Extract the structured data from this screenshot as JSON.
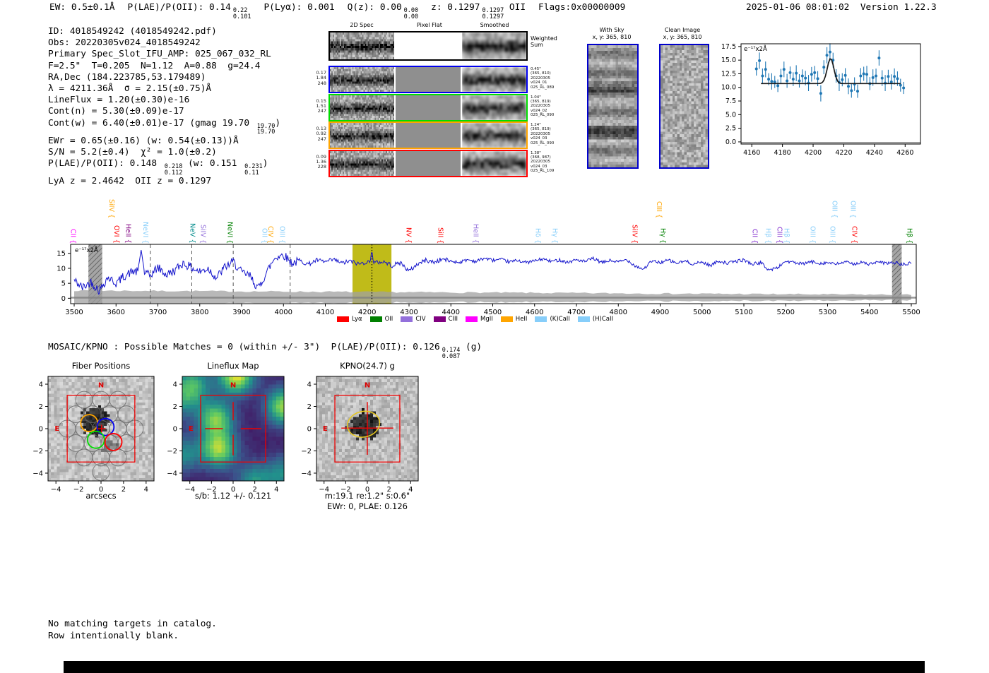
{
  "header": {
    "segments": [
      {
        "text": "EW: 0.5±0.1Å"
      },
      {
        "text": "P(LAE)/P(OII): 0.14",
        "sup": "0.22",
        "sub": "0.101"
      },
      {
        "text": "P(Lyα): 0.001"
      },
      {
        "text": "Q(z): 0.00",
        "sup": "0.00",
        "sub": "0.00"
      },
      {
        "text": "z: 0.1297",
        "sup": "0.1297",
        "sub": "0.1297",
        "after": " OII"
      },
      {
        "text": "Flags:0x00000009"
      }
    ],
    "timestamp": "2025-01-06 08:01:02",
    "version": "Version 1.22.3"
  },
  "info": {
    "lines": [
      [
        {
          "t": "ID: 4018549242 (4018549242.pdf)"
        }
      ],
      [
        {
          "t": "Obs: 20220305v024_4018549242"
        }
      ],
      [
        {
          "t": "Primary Spec_Slot_IFU_AMP: 025_067_032_RL"
        }
      ],
      [
        {
          "t": "F=2.5\"  T=0.205  N=1.12  A=0.88  g=24.4"
        }
      ],
      [
        {
          "t": "RA,Dec (184.223785,53.179489)"
        }
      ],
      [
        {
          "t": "λ = 4211.36Å  σ = 2.15(±0.75)Å"
        }
      ],
      [
        {
          "t": "LineFlux = 1.20(±0.30)e-16"
        }
      ],
      [
        {
          "t": "Cont(n) = 5.30(±0.09)e-17"
        }
      ],
      [
        {
          "t": "Cont(w) = 6.40(±0.01)e-17 (gmag 19.70 "
        },
        {
          "sup": "19.70",
          "sub": "19.70"
        },
        {
          "t": ")"
        }
      ],
      [
        {
          "t": "EWr = 0.65(±0.16) (w: 0.54(±0.13))Å"
        }
      ],
      [
        {
          "t": "S/N = 5.2(±0.4)  χ² = 1.0(±0.2)"
        }
      ],
      [
        {
          "t": "P(LAE)/P(OII): 0.148 "
        },
        {
          "sup": "0.218",
          "sub": "0.112"
        },
        {
          "t": " (w: 0.151 "
        },
        {
          "sup": "0.231",
          "sub": "0.11"
        },
        {
          "t": ")"
        }
      ],
      [
        {
          "t": "LyA z = 2.4642  OII z = 0.1297"
        }
      ]
    ]
  },
  "spec2d": {
    "col_titles": [
      "2D Spec",
      "Pixel Flat",
      "Smoothed"
    ],
    "weighted_label": "Weighted Sum",
    "rows": [
      {
        "left": [
          "0.17",
          "1.84",
          "248"
        ],
        "right": [
          "0.45\"",
          "(365, 810)",
          "20220305",
          "v024_01",
          "025_RL_089"
        ],
        "color": "#0000ee"
      },
      {
        "left": [
          "0.15",
          "1.51",
          "247"
        ],
        "right": [
          "1.04\"",
          "(365, 819)",
          "20220305",
          "v024_02",
          "025_RL_090"
        ],
        "color": "#00dd00"
      },
      {
        "left": [
          "0.13",
          "0.92",
          "247"
        ],
        "right": [
          "1.24\"",
          "(365, 819)",
          "20220305",
          "v024_03",
          "025_RL_090"
        ],
        "color": "#ffa500"
      },
      {
        "left": [
          "0.09",
          "1.36",
          "228"
        ],
        "right": [
          "1.38\"",
          "(368, 987)",
          "20220305",
          "v024_03",
          "025_RL_109"
        ],
        "color": "#ff0000"
      }
    ]
  },
  "cutouts": {
    "with_sky": {
      "title": "With Sky",
      "subtitle": "x, y: 365, 810"
    },
    "clean": {
      "title": "Clean Image",
      "subtitle": "x, y: 365, 810"
    }
  },
  "mosaic": {
    "prefix": "MOSAIC/KPNO : Possible Matches = 0 (within +/- 3\")  P(LAE)/P(OII): 0.126",
    "sup": "0.174",
    "sub": "0.087",
    "after": " (g)"
  },
  "footer": [
    "No matching targets in catalog.",
    "Row intentionally blank."
  ],
  "chart_data": [
    {
      "id": "zoom-spectrum",
      "type": "scatter",
      "annotation": "e⁻¹⁷x2Å",
      "x": [
        4163,
        4165,
        4167,
        4169,
        4171,
        4173,
        4175,
        4177,
        4179,
        4181,
        4183,
        4185,
        4187,
        4189,
        4191,
        4193,
        4195,
        4197,
        4199,
        4201,
        4203,
        4205,
        4207,
        4209,
        4211,
        4213,
        4215,
        4217,
        4219,
        4221,
        4223,
        4225,
        4227,
        4229,
        4231,
        4233,
        4235,
        4237,
        4239,
        4241,
        4243,
        4245,
        4247,
        4249,
        4251,
        4253,
        4255,
        4257,
        4259
      ],
      "y": [
        13.4,
        14.9,
        12.1,
        13.3,
        11.5,
        11.1,
        11.0,
        10.3,
        12.1,
        13.3,
        11.2,
        12.7,
        11.5,
        12.6,
        11.2,
        12.1,
        11.7,
        10.8,
        12.4,
        12.7,
        11.6,
        8.9,
        13.7,
        15.9,
        16.5,
        15.0,
        12.1,
        10.9,
        11.4,
        12.2,
        10.2,
        9.4,
        10.6,
        9.3,
        12.1,
        12.5,
        12.4,
        10.7,
        11.8,
        12.1,
        15.4,
        11.7,
        10.8,
        12.0,
        11.0,
        12.0,
        11.6,
        10.4,
        9.9
      ],
      "yerr": 1.1,
      "fit": {
        "center": 4211.36,
        "sigma": 2.15,
        "amplitude": 4.6,
        "baseline": 10.7,
        "x_start": 4166,
        "x_end": 4257
      },
      "xticks": [
        4160,
        4180,
        4200,
        4220,
        4240,
        4260
      ],
      "yticks": [
        0.0,
        2.5,
        5.0,
        7.5,
        10.0,
        12.5,
        15.0,
        17.5
      ],
      "xlim": [
        4153,
        4270
      ],
      "ylim": [
        -0.4,
        18.0
      ],
      "point_color": "#1f77b4",
      "fit_color": "#1a1a1a"
    },
    {
      "id": "full-spectrum",
      "type": "line",
      "annotation": "e⁻¹⁷x2Å",
      "x": [
        3500,
        3520,
        3540,
        3560,
        3580,
        3600,
        3620,
        3640,
        3652,
        3660,
        3668,
        3680,
        3700,
        3720,
        3740,
        3760,
        3780,
        3800,
        3820,
        3840,
        3860,
        3880,
        3900,
        3920,
        3940,
        3960,
        3980,
        4000,
        4020,
        4040,
        4060,
        4080,
        4100,
        4120,
        4140,
        4160,
        4180,
        4200,
        4207,
        4211,
        4215,
        4220,
        4240,
        4260,
        4280,
        4300,
        4320,
        4340,
        4360,
        4380,
        4400,
        4420,
        4440,
        4460,
        4480,
        4500,
        4520,
        4540,
        4560,
        4580,
        4600,
        4620,
        4640,
        4660,
        4680,
        4700,
        4720,
        4740,
        4760,
        4780,
        4800,
        4820,
        4840,
        4860,
        4880,
        4900,
        4920,
        4940,
        4960,
        4980,
        5000,
        5020,
        5040,
        5060,
        5080,
        5100,
        5120,
        5140,
        5160,
        5180,
        5200,
        5220,
        5240,
        5260,
        5280,
        5300,
        5320,
        5340,
        5360,
        5380,
        5400,
        5420,
        5440,
        5460,
        5480,
        5500
      ],
      "y": [
        6.0,
        3.5,
        5.5,
        2.5,
        7.0,
        5.0,
        7.5,
        9.0,
        8.8,
        16.2,
        8.6,
        7.5,
        10.3,
        7.8,
        9.2,
        11.8,
        10.2,
        8.8,
        10.0,
        6.8,
        10.4,
        12.2,
        8.6,
        7.4,
        3.2,
        8.8,
        13.6,
        14.6,
        11.8,
        12.4,
        11.4,
        12.7,
        12.1,
        12.9,
        11.7,
        12.4,
        11.4,
        12.2,
        11.8,
        16.5,
        11.6,
        11.9,
        12.2,
        10.9,
        11.9,
        9.0,
        11.4,
        12.7,
        12.0,
        13.1,
        12.4,
        12.0,
        12.9,
        12.3,
        13.4,
        12.7,
        12.9,
        12.1,
        12.7,
        11.9,
        12.5,
        13.1,
        12.3,
        12.8,
        12.0,
        12.9,
        12.2,
        13.3,
        11.9,
        12.6,
        12.1,
        12.9,
        10.9,
        9.7,
        12.4,
        11.9,
        12.7,
        11.7,
        12.4,
        11.4,
        12.1,
        10.9,
        12.5,
        11.7,
        12.3,
        12.8,
        11.4,
        11.9,
        9.4,
        10.2,
        12.4,
        11.9,
        11.4,
        12.2,
        11.7,
        11.9,
        11.3,
        12.1,
        11.5,
        11.9,
        11.4,
        12.0,
        11.7,
        11.9,
        11.2,
        11.7
      ],
      "xlim": [
        3491,
        5512
      ],
      "ylim": [
        -1.8,
        18.0
      ],
      "xticks": [
        3500,
        3600,
        3700,
        3800,
        3900,
        4000,
        4100,
        4200,
        4300,
        4400,
        4500,
        4600,
        4700,
        4800,
        4900,
        5000,
        5100,
        5200,
        5300,
        5400,
        5500
      ],
      "yticks": [
        0,
        5,
        10,
        15
      ],
      "line_color": "#1414cc",
      "highlight_band": {
        "x0": 4165,
        "x1": 4258,
        "color": "#b9b400"
      },
      "hatch_bands": [
        [
          3534,
          3567
        ],
        [
          5454,
          5477
        ]
      ],
      "dashed_lines": [
        3682,
        3781,
        3880,
        4016
      ],
      "dotted_line": 4211.36,
      "error_band": {
        "start_hw": 2.3,
        "end_hw": 0.85,
        "color": "#a0a0a0"
      },
      "legend": [
        {
          "label": "Lyα",
          "color": "#ff0000"
        },
        {
          "label": "OII",
          "color": "#008000"
        },
        {
          "label": "CIV",
          "color": "#9370db"
        },
        {
          "label": "CIII",
          "color": "#800080"
        },
        {
          "label": "MgII",
          "color": "#ff00ff"
        },
        {
          "label": "HeII",
          "color": "#ffa500"
        },
        {
          "label": "(K)CaII",
          "color": "#87cefa"
        },
        {
          "label": "(H)CaII",
          "color": "#87cefa"
        }
      ],
      "line_labels": [
        {
          "name": "CII",
          "wave": 3497,
          "color": "#ff00ff",
          "tier": 0
        },
        {
          "name": "SiIV",
          "wave": 3589,
          "color": "#ffa500",
          "tier": 1
        },
        {
          "name": "OVI",
          "wave": 3600,
          "color": "#ff0000",
          "tier": 0
        },
        {
          "name": "HeII",
          "wave": 3628,
          "color": "#800080",
          "tier": 0
        },
        {
          "name": "NeVI",
          "wave": 3670,
          "color": "#87cefa",
          "tier": 0
        },
        {
          "name": "NeV",
          "wave": 3782,
          "color": "#008b8b",
          "tier": 0
        },
        {
          "name": "SiIV",
          "wave": 3807,
          "color": "#9370db",
          "tier": 0
        },
        {
          "name": "NeVI",
          "wave": 3871,
          "color": "#008000",
          "tier": 0
        },
        {
          "name": "OII",
          "wave": 3954,
          "color": "#87cefa",
          "tier": 0
        },
        {
          "name": "CIV",
          "wave": 3968,
          "color": "#ffa500",
          "tier": 0
        },
        {
          "name": "OIII",
          "wave": 3996,
          "color": "#87cefa",
          "tier": 0
        },
        {
          "name": "NV",
          "wave": 4298,
          "color": "#ff0000",
          "tier": 0
        },
        {
          "name": "SiII",
          "wave": 4374,
          "color": "#ff0000",
          "tier": 0
        },
        {
          "name": "HeII",
          "wave": 4459,
          "color": "#9370db",
          "tier": 0
        },
        {
          "name": "Hδ",
          "wave": 4607,
          "color": "#87cefa",
          "tier": 0
        },
        {
          "name": "Hγ",
          "wave": 4648,
          "color": "#87cefa",
          "tier": 0
        },
        {
          "name": "SiIV",
          "wave": 4838,
          "color": "#ff0000",
          "tier": 0
        },
        {
          "name": "CIII",
          "wave": 4897,
          "color": "#ffa500",
          "tier": 1
        },
        {
          "name": "Hγ",
          "wave": 4906,
          "color": "#008000",
          "tier": 0
        },
        {
          "name": "CII",
          "wave": 5125,
          "color": "#7d26cd",
          "tier": 0
        },
        {
          "name": "Hβ",
          "wave": 5157,
          "color": "#87cefa",
          "tier": 0
        },
        {
          "name": "CIII",
          "wave": 5184,
          "color": "#7d26cd",
          "tier": 0
        },
        {
          "name": "Hβ",
          "wave": 5201,
          "color": "#87cefa",
          "tier": 0
        },
        {
          "name": "OIII",
          "wave": 5264,
          "color": "#87cefa",
          "tier": 0
        },
        {
          "name": "OIII",
          "wave": 5311,
          "color": "#87cefa",
          "tier": 0
        },
        {
          "name": "OIII",
          "wave": 5316,
          "color": "#87cefa",
          "tier": 1
        },
        {
          "name": "OIII",
          "wave": 5360,
          "color": "#87cefa",
          "tier": 1
        },
        {
          "name": "CIV",
          "wave": 5363,
          "color": "#ff0000",
          "tier": 0
        },
        {
          "name": "Hβ",
          "wave": 5495,
          "color": "#008000",
          "tier": 0
        }
      ]
    },
    {
      "id": "fiber-positions",
      "type": "scatter",
      "title": "Fiber Positions",
      "xlabel": "arcsecs",
      "ticks": [
        -4,
        -2,
        0,
        2,
        4
      ],
      "range": [
        -4.7,
        4.7
      ],
      "fiber_radius": 0.75,
      "gray_fibers": [
        [
          -1.5,
          2.6
        ],
        [
          0,
          2.6
        ],
        [
          1.5,
          2.6
        ],
        [
          -2.25,
          1.3
        ],
        [
          -0.75,
          1.3
        ],
        [
          0.75,
          1.3
        ],
        [
          2.25,
          1.3
        ],
        [
          -3,
          0
        ],
        [
          -1.5,
          0
        ],
        [
          0,
          0
        ],
        [
          1.5,
          0
        ],
        [
          3,
          0
        ],
        [
          -2.25,
          -1.3
        ],
        [
          -0.75,
          -1.3
        ],
        [
          0.75,
          -1.3
        ],
        [
          2.25,
          -1.3
        ],
        [
          -1.5,
          -2.6
        ],
        [
          0,
          -2.6
        ],
        [
          1.5,
          -2.6
        ],
        [
          0,
          -3.9
        ]
      ],
      "colored_fibers": [
        {
          "x": -1.05,
          "y": 0.5,
          "color": "#ffa500"
        },
        {
          "x": 0.4,
          "y": 0.15,
          "color": "#0000ee"
        },
        {
          "x": -0.45,
          "y": -1.0,
          "color": "#00dd00"
        },
        {
          "x": 1.1,
          "y": -1.2,
          "color": "#ff0000"
        }
      ],
      "box": [
        -3,
        3
      ],
      "north_label": "N",
      "east_label": "E",
      "cross": [
        0.05,
        0.0
      ]
    },
    {
      "id": "lineflux-map",
      "type": "heatmap",
      "title": "Lineflux Map",
      "xlabel": "s/b: 1.12 +/- 0.121",
      "ticks": [
        -4,
        -2,
        0,
        2,
        4
      ],
      "range": [
        -4.7,
        4.7
      ],
      "box": [
        -3,
        3
      ],
      "north_label": "N",
      "east_label": "E",
      "blobs": [
        [
          -1.6,
          0.9,
          0.8
        ],
        [
          -1.35,
          -1.85,
          0.9
        ],
        [
          0.3,
          4.8,
          1.05
        ],
        [
          4.7,
          2.0,
          0.9
        ],
        [
          -3.7,
          4.0,
          0.6
        ],
        [
          -4.7,
          -2.3,
          0.45
        ],
        [
          2.0,
          -4.7,
          0.5
        ],
        [
          4.7,
          -4.0,
          0.45
        ],
        [
          -4.7,
          2.5,
          0.4
        ]
      ],
      "palette": [
        "#440154",
        "#3b528b",
        "#21918c",
        "#5ec962",
        "#fde725"
      ]
    },
    {
      "id": "kpno-g",
      "type": "image",
      "title": "KPNO(24.7) g",
      "caption1": "m:19.1 re:1.2\" s:0.6\"",
      "caption2": "EWr: 0, PLAE: 0.126",
      "ticks": [
        -4,
        -2,
        0,
        2,
        4
      ],
      "range": [
        -4.7,
        4.7
      ],
      "box": [
        -3,
        3
      ],
      "north_label": "N",
      "east_label": "E",
      "blob": {
        "x": -0.35,
        "y": 0.45,
        "r": 1.25
      },
      "ellipse": {
        "x": -0.35,
        "y": 0.4,
        "rx": 1.5,
        "ry": 1.15,
        "angle": -12,
        "color": "#e8c81e"
      },
      "cross_extent": 2.4
    }
  ]
}
